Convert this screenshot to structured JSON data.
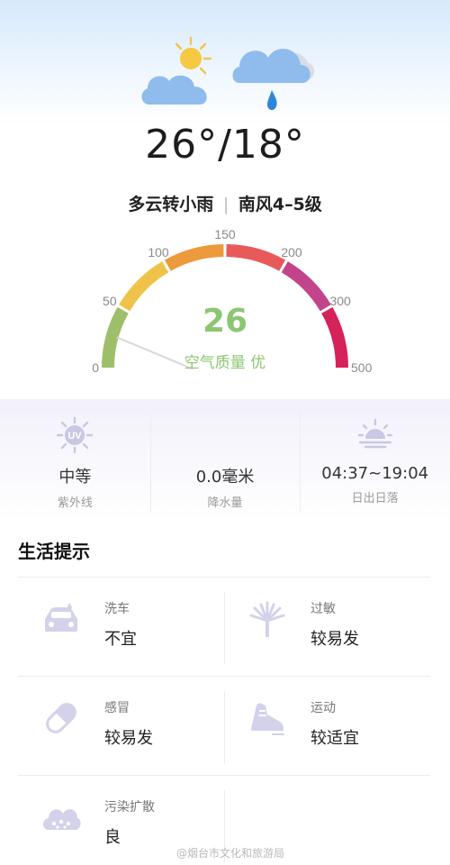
{
  "weather": {
    "high": "26°",
    "separator": "/",
    "low": "18°",
    "condition": "多云转小雨",
    "divider": "|",
    "wind": "南风4–5级",
    "icons": [
      "partly-cloudy-icon",
      "light-rain-icon"
    ]
  },
  "aqi": {
    "value": "26",
    "label": "空气质量 优",
    "scale_ticks": [
      "0",
      "50",
      "100",
      "150",
      "200",
      "300",
      "500"
    ],
    "current": 26,
    "colors": {
      "good": "#9dbf6a",
      "moderate": "#efc24a",
      "light": "#ec9a3c",
      "medium": "#e85a5a",
      "heavy": "#c2448a",
      "severe": "#d5225a",
      "value_text": "#8cc672"
    }
  },
  "info": [
    {
      "icon": "uv-icon",
      "value": "中等",
      "label": "紫外线"
    },
    {
      "icon": "precipitation-icon",
      "value": "0.0毫米",
      "label": "降水量"
    },
    {
      "icon": "sunrise-icon",
      "value": "04:37~19:04",
      "label": "日出日落"
    }
  ],
  "tips": {
    "title": "生活提示",
    "items": [
      {
        "icon": "car-wash-icon",
        "name": "洗车",
        "value": "不宜"
      },
      {
        "icon": "allergy-icon",
        "name": "过敏",
        "value": "较易发"
      },
      {
        "icon": "cold-pill-icon",
        "name": "感冒",
        "value": "较易发"
      },
      {
        "icon": "sport-shoe-icon",
        "name": "运动",
        "value": "较适宜"
      },
      {
        "icon": "pollution-cloud-icon",
        "name": "污染扩散",
        "value": "良"
      }
    ]
  },
  "watermark": "@烟台市文化和旅游局"
}
